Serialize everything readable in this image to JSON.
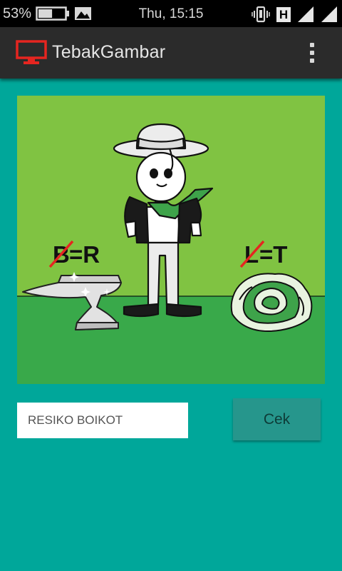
{
  "status_bar": {
    "battery_percent": "53%",
    "time": "Thu, 15:15",
    "network_type": "H",
    "battery_level": 0.53,
    "icons": [
      "battery-icon",
      "image-notification-icon",
      "vibrate-icon",
      "hspa-icon",
      "signal-icon",
      "signal-icon"
    ]
  },
  "app_bar": {
    "title": "TebakGambar",
    "icon": "tv-icon",
    "menu_icon": "overflow-menu-icon"
  },
  "puzzle": {
    "left_clue": {
      "struck": "B",
      "rest": "=R"
    },
    "right_clue": {
      "struck": "L",
      "rest": "=T"
    },
    "objects": [
      "anvil",
      "man-in-hat",
      "cabbage"
    ]
  },
  "answer": {
    "value": "RESIKO BOIKOT",
    "check_label": "Cek"
  },
  "colors": {
    "background": "#00a79a",
    "action_bar": "#2b2b2b",
    "app_icon": "#e52520",
    "puzzle_sky": "#80c342",
    "puzzle_ground": "#39a94a",
    "button": "#26968c",
    "strike": "#e52520"
  }
}
